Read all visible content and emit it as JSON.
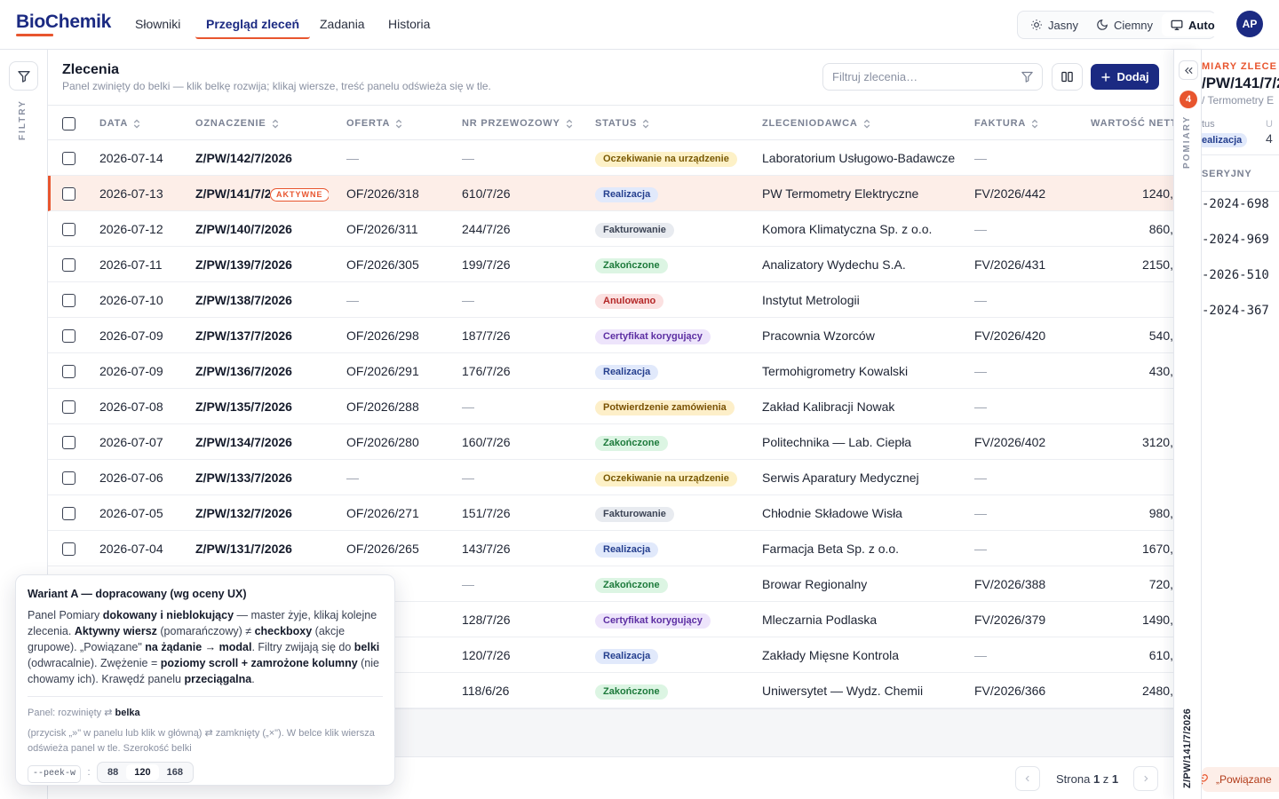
{
  "app": {
    "logo": "BioChemik",
    "avatar_initials": "AP",
    "accent": "#e8552e",
    "brand": "#1b2a82"
  },
  "nav": [
    {
      "label": "Słowniki",
      "active": false
    },
    {
      "label": "Przegląd zleceń",
      "active": true
    },
    {
      "label": "Zadania",
      "active": false
    },
    {
      "label": "Historia",
      "active": false
    }
  ],
  "theme": {
    "light": "Jasny",
    "dark": "Ciemny",
    "auto": "Auto",
    "selected": "Auto"
  },
  "filters_rail": {
    "label": "FILTRY",
    "icon": "filter-icon"
  },
  "main": {
    "title": "Zlecenia",
    "subtitle": "Panel zwinięty do belki — klik belkę rozwija; klikaj wiersze, treść panelu odświeża się w tle.",
    "search_placeholder": "Filtruj zlecenia…",
    "add_label": "Dodaj"
  },
  "columns": [
    "DATA",
    "OZNACZENIE",
    "OFERTA",
    "NR PRZEWOZOWY",
    "STATUS",
    "ZLECENIODAWCA",
    "FAKTURA",
    "WARTOŚĆ NETTO"
  ],
  "rows": [
    {
      "date": "2026-07-14",
      "code": "Z/PW/142/7/2026",
      "offer": "—",
      "transport": "—",
      "status": "Oczekiwanie na urządzenie",
      "kind": "wait",
      "client": "Laboratorium Usługowo-Badawcze",
      "invoice": "—",
      "value": ""
    },
    {
      "date": "2026-07-13",
      "code": "Z/PW/141/7/2026",
      "offer": "OF/2026/318",
      "transport": "610/7/26",
      "status": "Realizacja",
      "kind": "real",
      "client": "PW Termometry Elektryczne",
      "invoice": "FV/2026/442",
      "value": "1240,",
      "active": true,
      "active_label": "AKTYWNE"
    },
    {
      "date": "2026-07-12",
      "code": "Z/PW/140/7/2026",
      "offer": "OF/2026/311",
      "transport": "244/7/26",
      "status": "Fakturowanie",
      "kind": "fakt",
      "client": "Komora Klimatyczna Sp. z o.o.",
      "invoice": "—",
      "value": "860,"
    },
    {
      "date": "2026-07-11",
      "code": "Z/PW/139/7/2026",
      "offer": "OF/2026/305",
      "transport": "199/7/26",
      "status": "Zakończone",
      "kind": "done",
      "client": "Analizatory Wydechu S.A.",
      "invoice": "FV/2026/431",
      "value": "2150,"
    },
    {
      "date": "2026-07-10",
      "code": "Z/PW/138/7/2026",
      "offer": "—",
      "transport": "—",
      "status": "Anulowano",
      "kind": "anul",
      "client": "Instytut Metrologii",
      "invoice": "—",
      "value": ""
    },
    {
      "date": "2026-07-09",
      "code": "Z/PW/137/7/2026",
      "offer": "OF/2026/298",
      "transport": "187/7/26",
      "status": "Certyfikat korygujący",
      "kind": "cert",
      "client": "Pracownia Wzorców",
      "invoice": "FV/2026/420",
      "value": "540,"
    },
    {
      "date": "2026-07-09",
      "code": "Z/PW/136/7/2026",
      "offer": "OF/2026/291",
      "transport": "176/7/26",
      "status": "Realizacja",
      "kind": "real",
      "client": "Termohigrometry Kowalski",
      "invoice": "—",
      "value": "430,"
    },
    {
      "date": "2026-07-08",
      "code": "Z/PW/135/7/2026",
      "offer": "OF/2026/288",
      "transport": "—",
      "status": "Potwierdzenie zamówienia",
      "kind": "conf",
      "client": "Zakład Kalibracji Nowak",
      "invoice": "—",
      "value": ""
    },
    {
      "date": "2026-07-07",
      "code": "Z/PW/134/7/2026",
      "offer": "OF/2026/280",
      "transport": "160/7/26",
      "status": "Zakończone",
      "kind": "done",
      "client": "Politechnika — Lab. Ciepła",
      "invoice": "FV/2026/402",
      "value": "3120,"
    },
    {
      "date": "2026-07-06",
      "code": "Z/PW/133/7/2026",
      "offer": "—",
      "transport": "—",
      "status": "Oczekiwanie na urządzenie",
      "kind": "wait",
      "client": "Serwis Aparatury Medycznej",
      "invoice": "—",
      "value": ""
    },
    {
      "date": "2026-07-05",
      "code": "Z/PW/132/7/2026",
      "offer": "OF/2026/271",
      "transport": "151/7/26",
      "status": "Fakturowanie",
      "kind": "fakt",
      "client": "Chłodnie Składowe Wisła",
      "invoice": "—",
      "value": "980,"
    },
    {
      "date": "2026-07-04",
      "code": "Z/PW/131/7/2026",
      "offer": "OF/2026/265",
      "transport": "143/7/26",
      "status": "Realizacja",
      "kind": "real",
      "client": "Farmacja Beta Sp. z o.o.",
      "invoice": "—",
      "value": "1670,"
    },
    {
      "date": "",
      "code": "",
      "offer": "/260",
      "transport": "—",
      "status": "Zakończone",
      "kind": "done",
      "client": "Browar Regionalny",
      "invoice": "FV/2026/388",
      "value": "720,"
    },
    {
      "date": "",
      "code": "",
      "offer": "/255",
      "transport": "128/7/26",
      "status": "Certyfikat korygujący",
      "kind": "cert",
      "client": "Mleczarnia Podlaska",
      "invoice": "FV/2026/379",
      "value": "1490,"
    },
    {
      "date": "",
      "code": "",
      "offer": "/251",
      "transport": "120/7/26",
      "status": "Realizacja",
      "kind": "real",
      "client": "Zakłady Mięsne Kontrola",
      "invoice": "—",
      "value": "610,"
    },
    {
      "date": "",
      "code": "",
      "offer": "/244",
      "transport": "118/6/26",
      "status": "Zakończone",
      "kind": "done",
      "client": "Uniwersytet — Wydz. Chemii",
      "invoice": "FV/2026/366",
      "value": "2480,"
    }
  ],
  "pager": {
    "prefix": "Strona",
    "page": "1",
    "sep": "z",
    "total": "1"
  },
  "side_rail": {
    "label": "POMIARY",
    "count": "4",
    "order_vertical": "Z/PW/141/7/2026"
  },
  "peek": {
    "header": "MIARY ZLECE",
    "order": "/PW/141/7/2",
    "client": "/ Termometry E",
    "status_label": "tus",
    "status_value": "ealizacja",
    "col2_label": "U",
    "col2_value": "4",
    "serial_header": "SERYJNY",
    "serials": [
      "-2024-698",
      "-2024-969",
      "-2026-510",
      "-2024-367"
    ],
    "related": "„Powiązane"
  },
  "ux_note": {
    "title": "Wariant A — dopracowany (wg oceny UX)",
    "p1": "Panel Pomiary ",
    "p1b": "dokowany i nieblokujący",
    "p2": " — master żyje, klikaj kolejne zlecenia. ",
    "p2b": "Aktywny wiersz",
    "p3": " (pomarańczowy) ≠ ",
    "p3b": "checkboxy",
    "p4": " (akcje grupowe). „Powiązane\" ",
    "p4b": "na żądanie → modal",
    "p5": ". Filtry zwijają się do ",
    "p5b": "belki",
    "p6": " (odwracalnie). Zwężenie = ",
    "p6b": "poziomy scroll + zamrożone kolumny",
    "p7": " (nie chowamy ich). Krawędź panelu ",
    "p7b": "przeciągalna",
    "p8": ".",
    "state_prefix": "Panel: rozwinięty ⇄ ",
    "state_bold": "belka",
    "state_desc": "(przycisk „»\" w panelu lub klik w główną) ⇄ zamknięty („×\"). W belce klik wiersza odświeża panel w tle. Szerokość belki",
    "var_name": "--peek-w",
    "var_colon": ":",
    "widths": [
      "88",
      "120",
      "168"
    ],
    "selected_width": "120"
  }
}
